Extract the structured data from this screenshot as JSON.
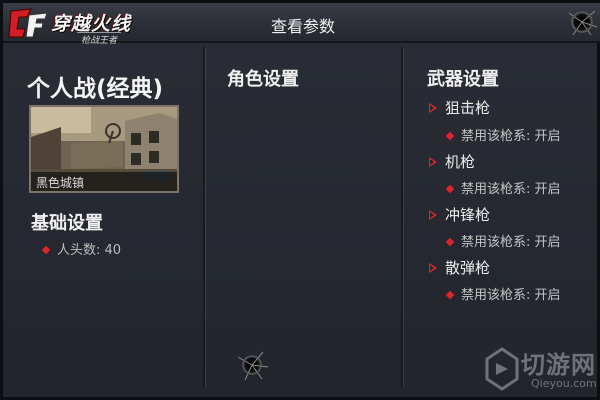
{
  "header": {
    "logo_title": "穿越火线",
    "logo_subtitle": "枪战王者",
    "page_title": "查看参数"
  },
  "left": {
    "mode_title": "个人战(经典)",
    "map_name": "黑色城镇",
    "basic_settings_title": "基础设置",
    "headcount": "人头数: 40"
  },
  "middle": {
    "title": "角色设置"
  },
  "right": {
    "title": "武器设置",
    "weapons": [
      {
        "name": "狙击枪",
        "setting": "禁用该枪系: 开启"
      },
      {
        "name": "机枪",
        "setting": "禁用该枪系: 开启"
      },
      {
        "name": "冲锋枪",
        "setting": "禁用该枪系: 开启"
      },
      {
        "name": "散弹枪",
        "setting": "禁用该枪系: 开启"
      }
    ]
  },
  "watermark": {
    "name": "切游网",
    "site": "Qieyou.com"
  },
  "colors": {
    "accent_red": "#e0262c",
    "panel_bg": "#22252c"
  },
  "icons": [
    "cf-logo-icon",
    "bullet-hole-icon",
    "diamond-bullet-icon",
    "triangle-bullet-icon",
    "qieyou-logo-icon"
  ]
}
